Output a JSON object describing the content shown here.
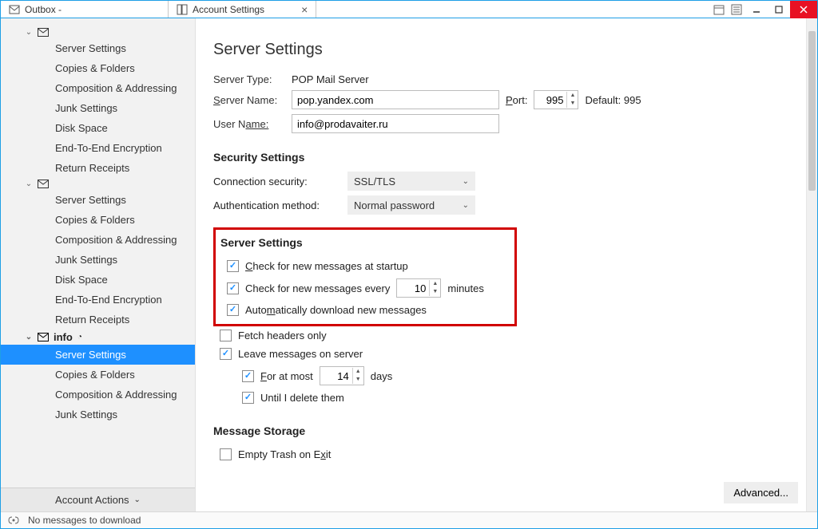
{
  "tabs": {
    "outbox": "Outbox -",
    "settings": "Account Settings"
  },
  "sidebar": {
    "account1": {
      "items": [
        "Server Settings",
        "Copies & Folders",
        "Composition & Addressing",
        "Junk Settings",
        "Disk Space",
        "End-To-End Encryption",
        "Return Receipts"
      ]
    },
    "account2": {
      "items": [
        "Server Settings",
        "Copies & Folders",
        "Composition & Addressing",
        "Junk Settings",
        "Disk Space",
        "End-To-End Encryption",
        "Return Receipts"
      ]
    },
    "account3": {
      "label": "info",
      "items": [
        "Server Settings",
        "Copies & Folders",
        "Composition & Addressing",
        "Junk Settings"
      ]
    },
    "account_actions": "Account Actions"
  },
  "page": {
    "title": "Server Settings",
    "server_type_label": "Server Type:",
    "server_type_value": "POP Mail Server",
    "server_name_label_pre": "S",
    "server_name_label_post": "erver Name:",
    "server_name_value": "pop.yandex.com",
    "port_label_pre": "P",
    "port_label_post": "ort:",
    "port_value": "995",
    "default_port": "Default: 995",
    "user_name_label_pre": "User N",
    "user_name_label_post": "ame:",
    "user_name_value": "info@prodavaiter.ru",
    "security_hdr": "Security Settings",
    "conn_sec_label": "Connection security:",
    "conn_sec_value": "SSL/TLS",
    "auth_method_label": "Authentication method:",
    "auth_method_value": "Normal password",
    "server_settings_hdr": "Server Settings",
    "chk_startup_pre": "C",
    "chk_startup_post": "heck for new messages at startup",
    "chk_every_pre": "Check for new messages every",
    "chk_every_value": "10",
    "chk_every_post": "minutes",
    "chk_auto_pre": "Auto",
    "chk_auto_mid": "m",
    "chk_auto_post": "atically download new messages",
    "chk_fetch": "Fetch headers only",
    "chk_leave": "Leave messages on server",
    "chk_atmost_pre": "F",
    "chk_atmost_mid": "or at most",
    "chk_atmost_value": "14",
    "chk_atmost_post": "days",
    "chk_until": "Until I delete them",
    "msg_storage_hdr": "Message Storage",
    "chk_empty_pre": "Empty Trash on E",
    "chk_empty_mid": "x",
    "chk_empty_post": "it",
    "advanced": "Advanced..."
  },
  "status": {
    "text": "No messages to download"
  }
}
